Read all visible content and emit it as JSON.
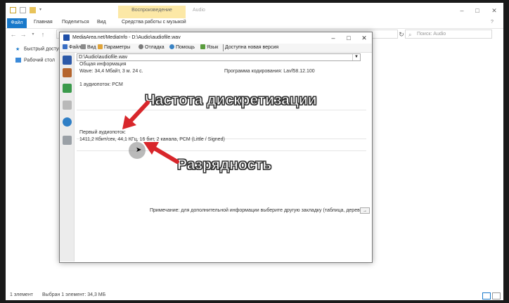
{
  "explorer": {
    "title": "Audio",
    "context_tab": "Воспроизведение",
    "ribbon_tabs": [
      "Файл",
      "Главная",
      "Поделиться",
      "Вид",
      "Средства работы с музыкой"
    ],
    "address": "Этот компьютер  ›  Локальный (D:)  ›  Audio",
    "search_placeholder": "Поиск: Audio",
    "nav_items": [
      "Быстрый доступ",
      "Рабочий стол"
    ],
    "status_count": "1 элемент",
    "status_selected": "Выбран 1 элемент: 34,3 МБ"
  },
  "mediainfo": {
    "title": "MediaArea.net/MediaInfo - D:\\Audio\\audiofile.wav",
    "menu": [
      "Файл",
      "Вид",
      "Параметры",
      "Отладка",
      "Помощь",
      "Язык",
      "Доступна новая версия"
    ],
    "file_path": "D:\\Audio\\audiofile.wav",
    "general_header": "Общая информация",
    "general_line": "Wave: 34,4 Мбайт, 3 м. 24 с.",
    "encoder": "Программа кодирования: Lavf58.12.100",
    "stream_count": "1 аудиопоток: PCM",
    "first_audio_header": "Первый аудиопоток:",
    "first_audio_line": "1411,2 Кбит/сек, 44,1 КГц, 16 бит, 2 канала, PCM (Little / Signed)",
    "note": "Примечание: для дополнительной информации выберите другую закладку (таблица, дерево...)",
    "note_button": "→"
  },
  "annotations": {
    "sample_rate": "Частота дискретизации",
    "bit_depth": "Разрядность"
  },
  "colors": {
    "accent": "#1979ca",
    "context_tab": "#fce8a6",
    "arrow": "#d8262b"
  }
}
